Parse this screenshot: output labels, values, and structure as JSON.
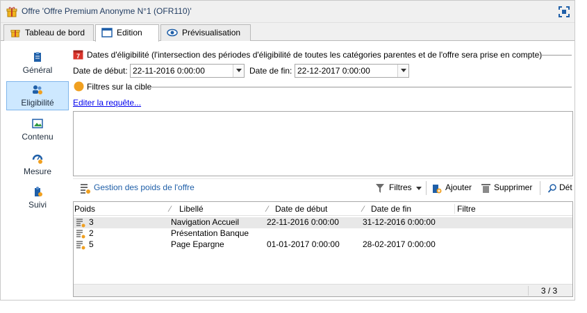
{
  "window": {
    "title": "Offre 'Offre Premium Anonyme N°1 (OFR110)'"
  },
  "tabs": [
    {
      "label": "Tableau de bord",
      "icon": "gift-icon"
    },
    {
      "label": "Edition",
      "icon": "form-icon",
      "active": true
    },
    {
      "label": "Prévisualisation",
      "icon": "eye-icon"
    }
  ],
  "sidebar": {
    "items": [
      {
        "label": "Général",
        "icon": "clipboard-icon"
      },
      {
        "label": "Eligibilité",
        "icon": "people-icon",
        "active": true
      },
      {
        "label": "Contenu",
        "icon": "image-icon"
      },
      {
        "label": "Mesure",
        "icon": "measure-icon"
      },
      {
        "label": "Suivi",
        "icon": "tracking-icon"
      }
    ]
  },
  "eligibility": {
    "section_title": "Dates d'éligibilité (l'intersection des périodes d'éligibilité de toutes les catégories parentes et de l'offre sera prise en compte)",
    "start_label": "Date de début:",
    "start_value": "22-11-2016 0:00:00",
    "end_label": "Date de fin:",
    "end_value": "22-12-2017 0:00:00"
  },
  "target": {
    "section_title": "Filtres sur la cible",
    "edit_link": "Editer la requête..."
  },
  "weights": {
    "title": "Gestion des poids de l'offre",
    "filters_label": "Filtres",
    "add_label": "Ajouter",
    "delete_label": "Supprimer",
    "detail_label": "Dét",
    "columns": [
      "Poids",
      "Libellé",
      "Date de début",
      "Date de fin",
      "Filtre"
    ],
    "rows": [
      {
        "poids": "3",
        "libelle": "Navigation Accueil",
        "debut": "22-11-2016 0:00:00",
        "fin": "31-12-2016 0:00:00",
        "filtre": ""
      },
      {
        "poids": "2",
        "libelle": "Présentation Banque",
        "debut": "",
        "fin": "",
        "filtre": ""
      },
      {
        "poids": "5",
        "libelle": "Page Epargne",
        "debut": "01-01-2017 0:00:00",
        "fin": "28-02-2017 0:00:00",
        "filtre": ""
      }
    ],
    "count": "3 / 3"
  },
  "colors": {
    "accent": "#1f5fa8",
    "selection": "#cde8ff",
    "calendar": "#d9342b",
    "filter_dot": "#f0a020"
  }
}
